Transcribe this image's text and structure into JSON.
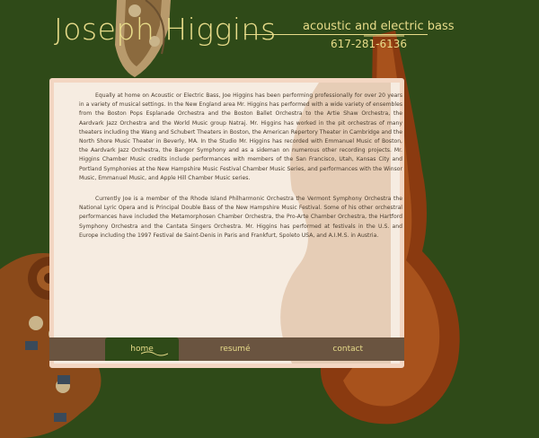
{
  "header": {
    "title": "Joseph Higgins",
    "tagline": "acoustic and electric bass",
    "phone": "617-281-6136"
  },
  "content": {
    "paragraphs": [
      "Equally at home on Acoustic or Electric Bass, Joe Higgins has been performing professionally for over 20 years in a variety of musical settings. In the New England area Mr. Higgins has performed with a wide variety of ensembles from the Boston Pops Esplanade Orchestra and the Boston Ballet Orchestra to the Artie Shaw Orchestra, the Aardvark Jazz Orchestra and the World Music group Natraj. Mr. Higgins has worked in the pit orchestras of many theaters including the Wang and Schubert Theaters in Boston, the American Repertory Theater in Cambridge and the North Shore Music Theater in Beverly, MA. In the Studio Mr. Higgins has recorded with Emmanuel Music of Boston, the Aardvark Jazz Orchestra, the Bangor Symphony and as a sideman on numerous other recording projects. Mr. Higgins Chamber Music credits include performances with members of the San Francisco, Utah, Kansas City and Portland Symphonies at the New Hampshire Music Festival Chamber Music Series, and performances with the Winsor Music, Emmanuel Music, and Apple Hill Chamber Music series.",
      "Currently Joe is a member of the Rhode Island Philharmonic Orchestra the Vermont Symphony Orchestra the National Lyric Opera and is Principal Double Bass of the New Hampshire Music Festival. Some of his other orchestral performances have included the Metamorphosen Chamber Orchestra, the Pro-Arte Chamber Orchestra, the Hartford Symphony Orchestra and the Cantata Singers Orchestra. Mr. Higgins has performed at festivals in the U.S. and Europe including the 1997 Festival de Saint-Denis in Paris and Frankfurt, Spoleto USA, and A.I.M.S. in Austria."
    ]
  },
  "nav": {
    "home": "home",
    "resume": "resumé",
    "contact": "contact"
  },
  "colors": {
    "background": "#2f4a18",
    "accent": "#e8dc8a",
    "panel": "#f6ece1",
    "nav_bar": "#6a5440"
  }
}
